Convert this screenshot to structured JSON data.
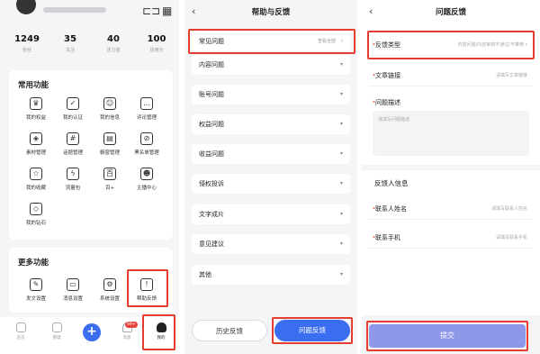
{
  "profile": {
    "stats": [
      {
        "value": "1249",
        "label": "粉丝"
      },
      {
        "value": "35",
        "label": "关注"
      },
      {
        "value": "40",
        "label": "活力值"
      },
      {
        "value": "100",
        "label": "信用分"
      }
    ]
  },
  "common_functions": {
    "title": "常用功能",
    "items": [
      {
        "label": "我的权益",
        "icon": "crown-icon",
        "glyph": "♛"
      },
      {
        "label": "我的认证",
        "icon": "badge-check-icon",
        "glyph": "✓"
      },
      {
        "label": "我的信息",
        "icon": "user-card-icon",
        "glyph": "☺"
      },
      {
        "label": "评论管理",
        "icon": "comment-icon",
        "glyph": "…"
      },
      {
        "label": "素材管理",
        "icon": "cube-icon",
        "glyph": "◈"
      },
      {
        "label": "话题管理",
        "icon": "topic-icon",
        "glyph": "#"
      },
      {
        "label": "橱窗管理",
        "icon": "shop-icon",
        "glyph": "▤"
      },
      {
        "label": "黑名单管理",
        "icon": "blacklist-icon",
        "glyph": "⊘"
      },
      {
        "label": "我的收藏",
        "icon": "star-icon",
        "glyph": "☆"
      },
      {
        "label": "流量包",
        "icon": "lightning-icon",
        "glyph": "ϟ"
      },
      {
        "label": "百+",
        "icon": "hundred-plus-icon",
        "glyph": "百"
      },
      {
        "label": "主播中心",
        "icon": "anchor-icon",
        "glyph": "☻"
      },
      {
        "label": "我的钻石",
        "icon": "diamond-icon",
        "glyph": "◇"
      }
    ]
  },
  "more_functions": {
    "title": "更多功能",
    "items": [
      {
        "label": "发文设置",
        "icon": "edit-icon",
        "glyph": "✎"
      },
      {
        "label": "消息设置",
        "icon": "message-icon",
        "glyph": "▭"
      },
      {
        "label": "系统设置",
        "icon": "settings-icon",
        "glyph": "⚙"
      },
      {
        "label": "帮助反馈",
        "icon": "help-icon",
        "glyph": "!"
      }
    ]
  },
  "bottom_nav": {
    "items": [
      {
        "label": "首页"
      },
      {
        "label": "管理"
      },
      {
        "label": "消息"
      },
      {
        "label": "我的"
      }
    ],
    "badge": "99+"
  },
  "help": {
    "title": "帮助与反馈",
    "faq_items": [
      {
        "label": "常见问题",
        "sub": "查看全部"
      },
      {
        "label": "内容问题"
      },
      {
        "label": "账号问题"
      },
      {
        "label": "权益问题"
      },
      {
        "label": "收益问题"
      },
      {
        "label": "侵权投诉"
      },
      {
        "label": "文字成片"
      },
      {
        "label": "意见建议"
      },
      {
        "label": "其他"
      }
    ],
    "history_button": "历史反馈",
    "feedback_button": "问题反馈"
  },
  "feedback_form": {
    "title": "问题反馈",
    "type_label": "反馈类型",
    "type_placeholder": "内容问题/内容审核不通过/不推荐",
    "link_label": "文章链接",
    "link_placeholder": "请填写文章链接",
    "desc_label": "问题描述",
    "desc_placeholder": "请填写问题描述",
    "info_title": "反馈人信息",
    "name_label": "联系人姓名",
    "name_placeholder": "请填写联系人姓名",
    "phone_label": "联系手机",
    "phone_placeholder": "请填写联系手机",
    "submit": "提交"
  },
  "colors": {
    "accent": "#3b6df0",
    "highlight": "#e53d30",
    "submit": "#8f98e8"
  }
}
